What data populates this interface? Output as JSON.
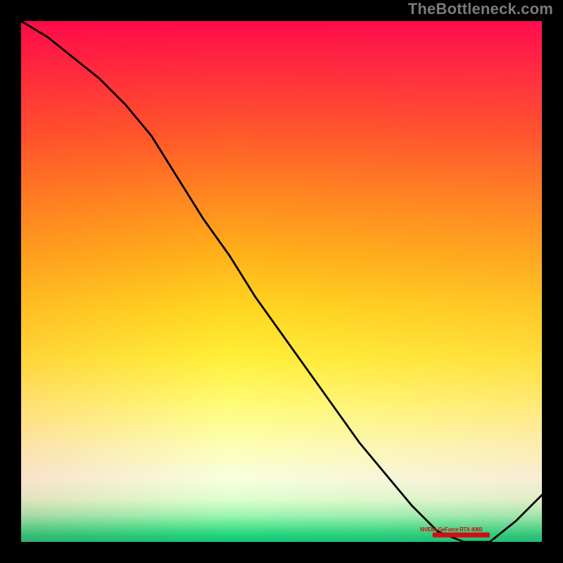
{
  "attribution": "TheBottleneck.com",
  "chart_data": {
    "type": "line",
    "title": "",
    "xlabel": "",
    "ylabel": "",
    "xlim": [
      0,
      100
    ],
    "ylim": [
      0,
      100
    ],
    "grid": false,
    "legend": false,
    "annotations": [
      {
        "text": "NVIDIA GeForce RTX 4060",
        "x": 82,
        "y": 2.2
      }
    ],
    "series": [
      {
        "name": "bottleneck-curve",
        "color": "#000000",
        "x": [
          0,
          5,
          10,
          15,
          20,
          25,
          30,
          35,
          40,
          45,
          50,
          55,
          60,
          65,
          70,
          75,
          80,
          85,
          90,
          95,
          100
        ],
        "y": [
          100,
          97,
          93,
          89,
          84,
          78,
          70,
          62,
          55,
          47,
          40,
          33,
          26,
          19,
          13,
          7,
          2,
          0,
          0,
          4,
          9
        ]
      }
    ],
    "optimum_band": {
      "x_start": 79,
      "x_end": 90,
      "y": 1.4
    }
  }
}
